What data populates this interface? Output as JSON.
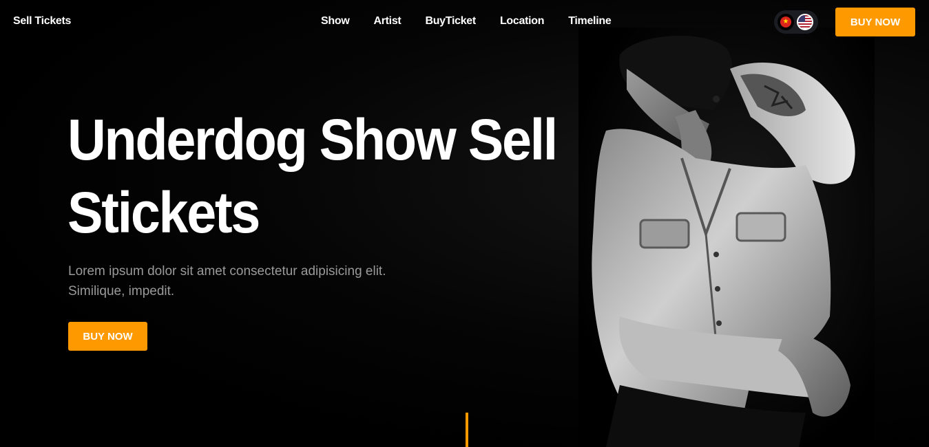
{
  "brand": "Sell Tickets",
  "nav": {
    "links": [
      "Show",
      "Artist",
      "BuyTicket",
      "Location",
      "Timeline"
    ],
    "buy_label": "BUY NOW"
  },
  "languages": [
    {
      "code": "vi",
      "icon": "vietnam-flag-icon"
    },
    {
      "code": "en",
      "icon": "us-flag-icon"
    }
  ],
  "hero": {
    "title": "Underdog Show Sell Stickets",
    "description": "Lorem ipsum dolor sit amet consectetur adipisicing elit. Similique, impedit.",
    "buy_label": "BUY NOW"
  },
  "colors": {
    "accent": "#fe9a00",
    "background": "#000000",
    "text": "#ffffff",
    "muted": "#9a9a9a"
  }
}
